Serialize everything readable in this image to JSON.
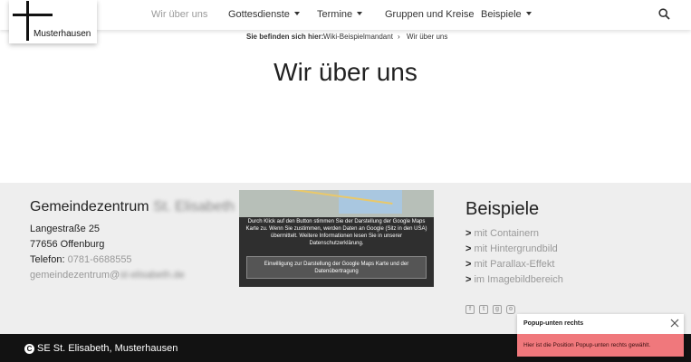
{
  "header": {
    "logo_text": "Musterhausen",
    "nav": [
      {
        "label": "Wir über uns",
        "dropdown": false,
        "active": true
      },
      {
        "label": "Gottesdienste",
        "dropdown": true,
        "active": false
      },
      {
        "label": "Termine",
        "dropdown": true,
        "active": false
      },
      {
        "label": "Gruppen und Kreise",
        "dropdown": false,
        "active": false
      },
      {
        "label": "Beispiele",
        "dropdown": true,
        "active": false
      }
    ],
    "search_icon": "search-icon"
  },
  "breadcrumb": {
    "label": "Sie befinden sich hier:",
    "items": [
      "Wiki-Beispielmandant",
      "Wir über uns"
    ],
    "separator": "›"
  },
  "main": {
    "title": "Wir über uns"
  },
  "footer": {
    "org_name": "Gemeindezentrum",
    "org_name_blurred": "St. Elisabeth",
    "street": "Langestraße 25",
    "city": "77656 Offenburg",
    "phone_label": "Telefon:",
    "phone_value": "0781-6688555",
    "email_user": "gemeindezentrum@",
    "email_domain_blurred": "st-elisabeth.de",
    "map": {
      "consent_text": "Durch Klick auf den Button stimmen Sie der Darstellung der Google Maps Karte zu. Wenn Sie zustimmen, werden Daten an Google (Sitz in den USA) übermittelt. Weitere Informationen lesen Sie in unserer Datenschutzerklärung.",
      "button_label": "Einwilligung zur Darstellung der Google Maps Karte und der Datenübertragung"
    },
    "examples": {
      "title": "Beispiele",
      "items": [
        "mit Containern",
        "mit Hintergrundbild",
        "mit Parallax-Effekt",
        "im Imagebildbereich"
      ],
      "arrow": ">"
    },
    "social_icons": [
      "facebook-icon",
      "twitter-icon",
      "google-plus-icon",
      "instagram-icon"
    ]
  },
  "bottom_bar": {
    "copyright_symbol": "C",
    "text": "SE St. Elisabeth, Musterhausen"
  },
  "popup": {
    "title": "Popup-unten rechts",
    "body": "Hier ist die Position Popup-unten rechts gewählt.",
    "body_color": "#f0787c"
  },
  "colors": {
    "footer_bg": "#eeeeee",
    "bottom_bar_bg": "#121212",
    "link_gray": "#999999"
  }
}
